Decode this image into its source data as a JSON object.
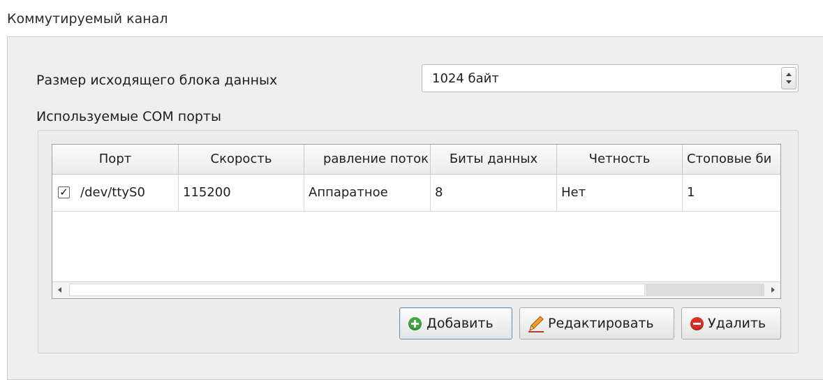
{
  "group": {
    "title": "Коммутируемый канал"
  },
  "block_size": {
    "label": "Размер исходящего блока данных",
    "value": "1024 байт"
  },
  "ports": {
    "label": "Используемые COM порты",
    "columns": [
      "Порт",
      "Скорость",
      "равление поток",
      "Биты данных",
      "Четность",
      "Стоповые би"
    ],
    "rows": [
      {
        "checked": true,
        "check_glyph": "✓",
        "port": "/dev/ttyS0",
        "speed": "115200",
        "flow": "Аппаратное",
        "data_bits": "8",
        "parity": "Нет",
        "stop_bits": "1"
      }
    ]
  },
  "buttons": {
    "add": "Добавить",
    "edit": "Редактировать",
    "delete": "Удалить"
  },
  "icons": {
    "add": "add-circle-icon",
    "edit": "pencil-icon",
    "delete": "remove-circle-icon"
  },
  "colors": {
    "add": "#3fa83f",
    "delete": "#d9302a",
    "edit_pencil": "#f0a020"
  }
}
